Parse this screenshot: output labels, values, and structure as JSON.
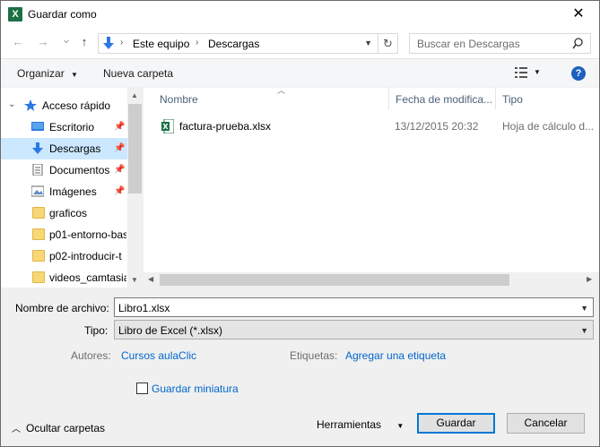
{
  "window": {
    "title": "Guardar como",
    "app_icon": "excel-icon",
    "close_glyph": "✕"
  },
  "nav": {
    "back_glyph": "←",
    "forward_glyph": "→",
    "recent_glyph": "⌄",
    "up_glyph": "↑",
    "address": [
      "Este equipo",
      "Descargas"
    ],
    "search_placeholder": "Buscar en Descargas"
  },
  "toolbar": {
    "organize": "Organizar",
    "new_folder": "Nueva carpeta",
    "help": "?"
  },
  "sidebar": {
    "quick_access": "Acceso rápido",
    "items": [
      {
        "label": "Escritorio",
        "icon": "desktop-icon",
        "pinned": true
      },
      {
        "label": "Descargas",
        "icon": "download-icon",
        "pinned": true,
        "selected": true
      },
      {
        "label": "Documentos",
        "icon": "document-icon",
        "pinned": true
      },
      {
        "label": "Imágenes",
        "icon": "pictures-icon",
        "pinned": true
      },
      {
        "label": "graficos",
        "icon": "folder-icon"
      },
      {
        "label": "p01-entorno-bas",
        "icon": "folder-icon"
      },
      {
        "label": "p02-introducir-t",
        "icon": "folder-icon"
      },
      {
        "label": "videos_camtasia",
        "icon": "folder-icon"
      }
    ]
  },
  "columns": {
    "name": "Nombre",
    "date": "Fecha de modifica...",
    "type": "Tipo"
  },
  "files": [
    {
      "name": "factura-prueba.xlsx",
      "date": "13/12/2015 20:32",
      "type": "Hoja de cálculo d..."
    }
  ],
  "form": {
    "filename_label": "Nombre de archivo:",
    "filename_value": "Libro1.xlsx",
    "type_label": "Tipo:",
    "type_value": "Libro de Excel (*.xlsx)",
    "authors_label": "Autores:",
    "authors_value": "Cursos aulaClic",
    "tags_label": "Etiquetas:",
    "tags_value": "Agregar una etiqueta",
    "thumbnail_label": "Guardar miniatura"
  },
  "footer": {
    "hide_folders": "Ocultar carpetas",
    "tools": "Herramientas",
    "save": "Guardar",
    "cancel": "Cancelar"
  }
}
